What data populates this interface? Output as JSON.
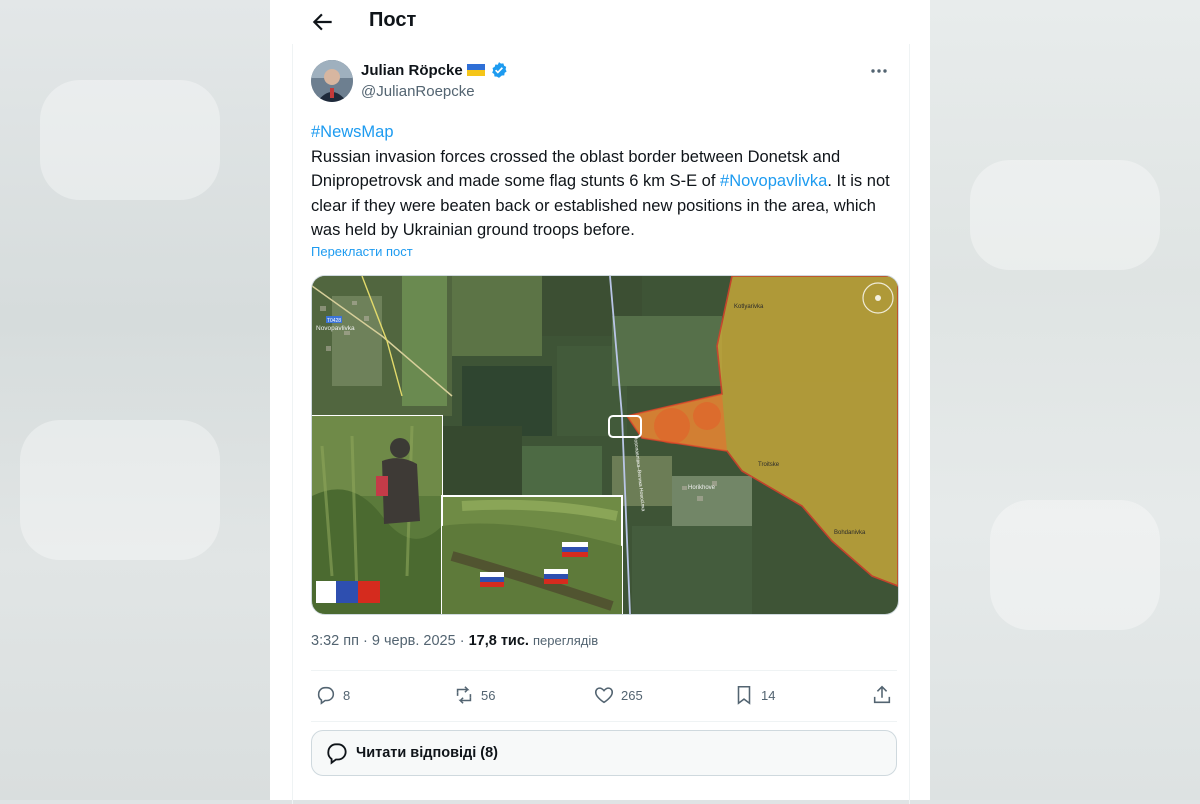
{
  "header": {
    "title": "Пост"
  },
  "tweet": {
    "author_name": "Julian Röpcke",
    "handle": "@JulianRoepcke",
    "hashtag_top": "#NewsMap",
    "text_part1": "Russian invasion forces crossed the oblast border between Donetsk and Dnipropetrovsk and made some flag stunts 6 km S-E of ",
    "hashtag_inline": "#Novopavlivka",
    "text_part2": ". It is not clear if they were beaten back or established new positions in the area, which was held by Ukrainian ground troops before.",
    "translate_label": "Перекласти пост",
    "time": "3:32 пп",
    "date": "9 черв. 2025",
    "dot": "·",
    "views_count": "17,8 тис.",
    "views_label": "переглядів"
  },
  "media": {
    "map_labels": {
      "novopavlivka": "Novopavlivka",
      "route": "T0428",
      "kotlyarivka": "Kotlyarivka",
      "horikhove": "Horikhove",
      "troitske": "Troitske",
      "bohdanivka": "Bohdanivka",
      "road": "Новопавлівка–Велика Новосілка"
    }
  },
  "actions": {
    "replies": "8",
    "reposts": "56",
    "likes": "265",
    "bookmarks": "14"
  },
  "read_replies": "Читати відповіді (8)",
  "colors": {
    "accent": "#1d9bf0",
    "text": "#0f1419",
    "secondary": "#536471",
    "occupied_zone": "#c8a93a",
    "occupied_border": "#e0402a"
  }
}
